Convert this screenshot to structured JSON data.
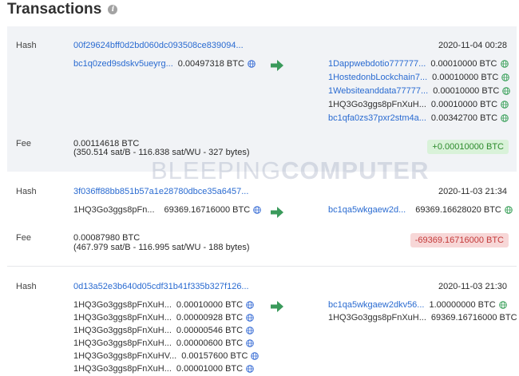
{
  "header": {
    "title": "Transactions",
    "info_glyph": "i"
  },
  "watermark": {
    "part1": "BLEEPING",
    "part2": "COMPUTER"
  },
  "labels": {
    "hash": "Hash",
    "fee": "Fee"
  },
  "colors": {
    "link": "#2a6bd1",
    "arrow": "#3a9a5b",
    "globe_blue": "#3b6fd6",
    "globe_green": "#3aa05a",
    "globe_red": "#d64a3b"
  },
  "transactions": [
    {
      "hash": "00f29624bff0d2bd060dc093508ce839094...",
      "date": "2020-11-04 00:28",
      "inputs": [
        {
          "address": "bc1q0zed9sdskv5ueyrg...",
          "amount": "0.00497318 BTC",
          "globe": "blue"
        }
      ],
      "outputs": [
        {
          "address": "1Dappwebdotio777777...",
          "amount": "0.00010000 BTC",
          "globe": "green"
        },
        {
          "address": "1HostedonbLockchain7...",
          "amount": "0.00010000 BTC",
          "globe": "green"
        },
        {
          "address": "1Websiteanddata77777...",
          "amount": "0.00010000 BTC",
          "globe": "green"
        },
        {
          "address": "1HQ3Go3ggs8pFnXuH...",
          "amount": "0.00010000 BTC",
          "globe": "green",
          "plain": true
        },
        {
          "address": "bc1qfa0zs37pxr2stm4a...",
          "amount": "0.00342700 BTC",
          "globe": "green"
        }
      ],
      "fee": "0.00114618 BTC",
      "fee_detail": "(350.514 sat/B - 116.838 sat/WU - 327 bytes)",
      "balance": "+0.00010000 BTC"
    },
    {
      "hash": "3f036ff88bb851b57a1e28780dbce35a6457...",
      "date": "2020-11-03 21:34",
      "inputs": [
        {
          "address": "1HQ3Go3ggs8pFn...",
          "amount": "69369.16716000 BTC",
          "globe": "blue",
          "plain": true
        }
      ],
      "outputs": [
        {
          "address": "bc1qa5wkgaew2d...",
          "amount": "69369.16628020 BTC",
          "globe": "green"
        }
      ],
      "fee": "0.00087980 BTC",
      "fee_detail": "(467.979 sat/B - 116.995 sat/WU - 188 bytes)",
      "balance": "-69369.16716000 BTC"
    },
    {
      "hash": "0d13a52e3b640d05cdf31b41f335b327f126...",
      "date": "2020-11-03 21:30",
      "inputs": [
        {
          "address": "1HQ3Go3ggs8pFnXuH...",
          "amount": "0.00010000 BTC",
          "globe": "blue",
          "plain": true
        },
        {
          "address": "1HQ3Go3ggs8pFnXuH...",
          "amount": "0.00000928 BTC",
          "globe": "blue",
          "plain": true
        },
        {
          "address": "1HQ3Go3ggs8pFnXuH...",
          "amount": "0.00000546 BTC",
          "globe": "blue",
          "plain": true
        },
        {
          "address": "1HQ3Go3ggs8pFnXuH...",
          "amount": "0.00000600 BTC",
          "globe": "blue",
          "plain": true
        },
        {
          "address": "1HQ3Go3ggs8pFnXuHV...",
          "amount": "0.00157600 BTC",
          "globe": "blue",
          "plain": true
        },
        {
          "address": "1HQ3Go3ggs8pFnXuH...",
          "amount": "0.00001000 BTC",
          "globe": "blue",
          "plain": true
        }
      ],
      "outputs": [
        {
          "address": "bc1qa5wkgaew2dkv56...",
          "amount": "1.00000000 BTC",
          "globe": "green"
        },
        {
          "address": "1HQ3Go3ggs8pFnXuH...",
          "amount": "69369.16716000 BTC",
          "globe": "red",
          "plain": true
        }
      ]
    }
  ]
}
